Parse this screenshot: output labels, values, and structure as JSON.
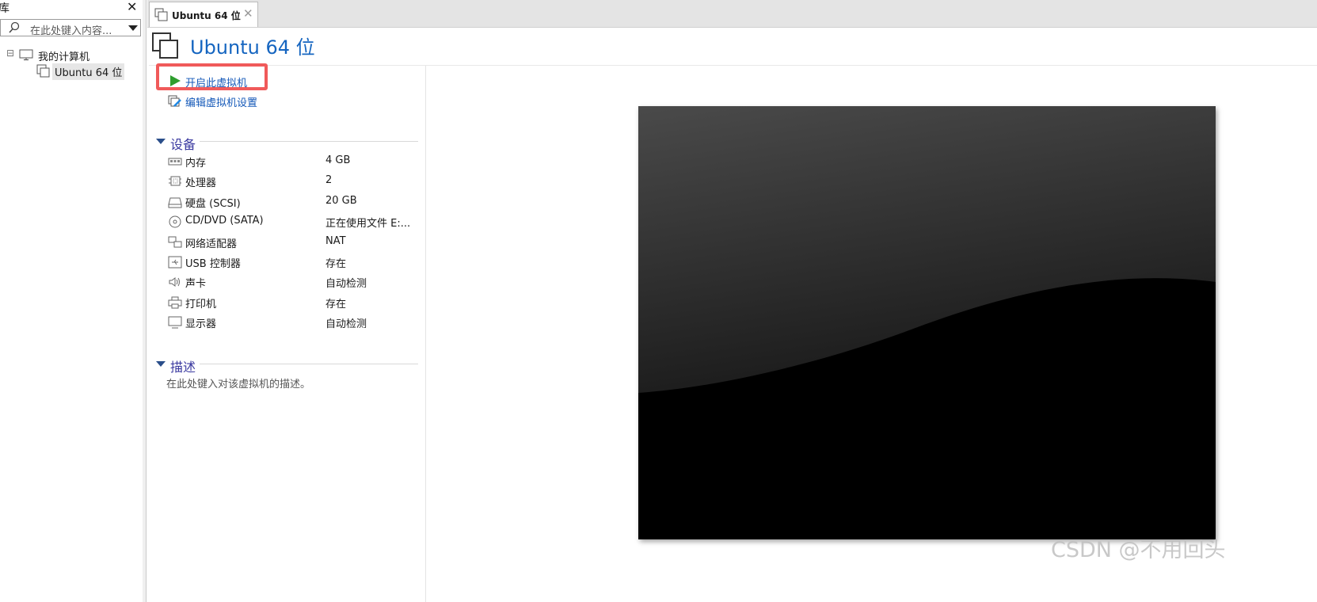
{
  "library": {
    "title": "库",
    "close_symbol": "✕",
    "search_placeholder": "在此处键入内容...",
    "tree": {
      "root_label": "我的计算机",
      "root_toggle": "⊟",
      "vm_label": "Ubuntu 64 位"
    }
  },
  "tabs": [
    {
      "label": "Ubuntu 64 位",
      "close_symbol": "✕"
    }
  ],
  "vm": {
    "title": "Ubuntu 64 位",
    "actions": {
      "power_on": "开启此虚拟机",
      "edit_settings": "编辑虚拟机设置"
    },
    "devices_heading": "设备",
    "devices": [
      {
        "icon": "memory-icon",
        "name": "内存",
        "value": "4 GB"
      },
      {
        "icon": "processor-icon",
        "name": "处理器",
        "value": "2"
      },
      {
        "icon": "hard-disk-icon",
        "name": "硬盘 (SCSI)",
        "value": "20 GB"
      },
      {
        "icon": "cd-dvd-icon",
        "name": "CD/DVD (SATA)",
        "value": "正在使用文件 E:..."
      },
      {
        "icon": "network-adapter-icon",
        "name": "网络适配器",
        "value": "NAT"
      },
      {
        "icon": "usb-controller-icon",
        "name": "USB 控制器",
        "value": "存在"
      },
      {
        "icon": "sound-card-icon",
        "name": "声卡",
        "value": "自动检测"
      },
      {
        "icon": "printer-icon",
        "name": "打印机",
        "value": "存在"
      },
      {
        "icon": "display-icon",
        "name": "显示器",
        "value": "自动检测"
      }
    ],
    "description_heading": "描述",
    "description_placeholder": "在此处键入对该虚拟机的描述。"
  },
  "watermark": "CSDN @不用回头",
  "colors": {
    "link_blue": "#1458b8",
    "title_blue": "#1565c0",
    "section_heading": "#3b3aa0",
    "highlight_red": "#f05a5a",
    "play_green": "#2e9e2e"
  }
}
